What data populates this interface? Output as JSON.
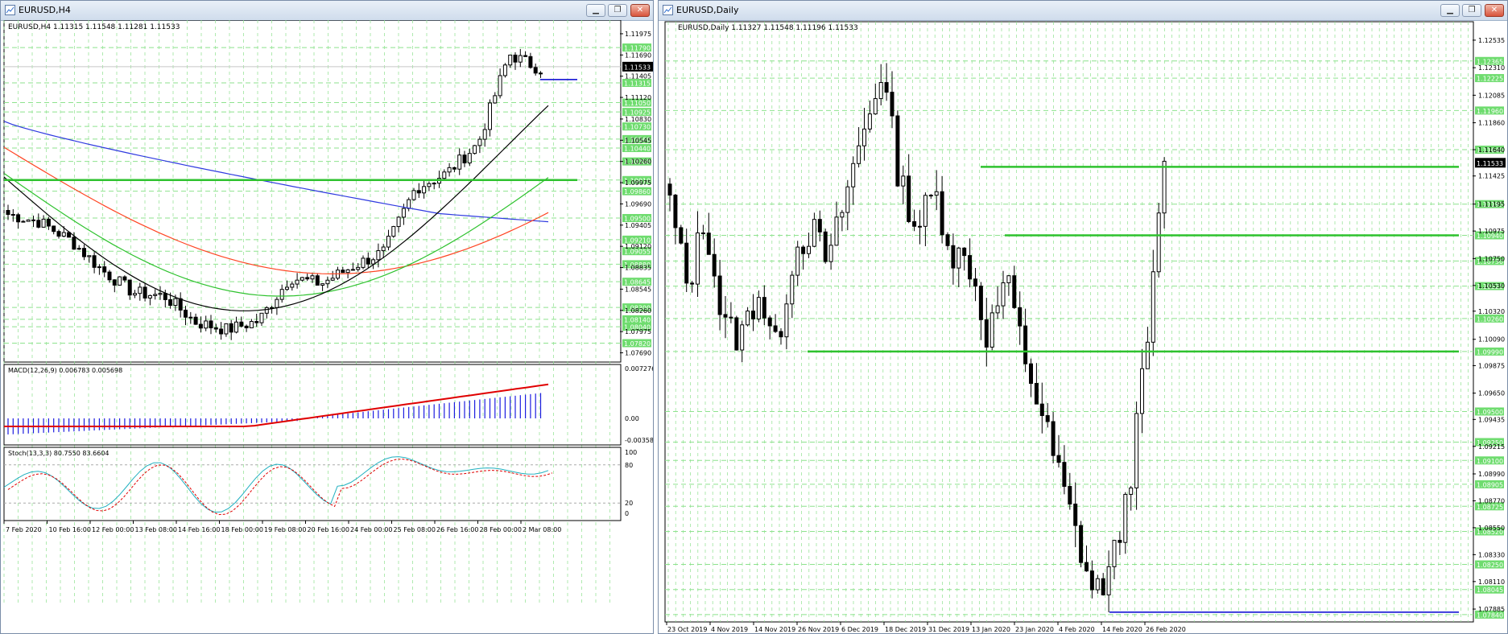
{
  "colors": {
    "accent_green": "#2ec22e",
    "grid_dash": "#8ee28e",
    "ma_blue": "#2f3ae0",
    "ma_red": "#ff4422",
    "ma_green": "#2ec22e",
    "ma_black": "#000000",
    "macd_hist": "#1c1ce0",
    "macd_signal": "#e00000",
    "stoch_main": "#20b0c0",
    "stoch_signal": "#e00000",
    "hline_blue": "#0000d0"
  },
  "icons": {
    "window_icon": "chart-window-icon",
    "minimize": "minimize-icon",
    "restore": "restore-icon",
    "close": "close-icon"
  },
  "left": {
    "title": "EURUSD,H4",
    "ohlc_label": "EURUSD,H4  1.11315 1.11548 1.11281 1.11533",
    "price_axis_ticks": [
      "1.11975",
      "1.11690",
      "1.11405",
      "1.11120",
      "1.10830",
      "1.10545",
      "1.10260",
      "1.09975",
      "1.09690",
      "1.09405",
      "1.09120",
      "1.08835",
      "1.08545",
      "1.08260",
      "1.07975",
      "1.07690"
    ],
    "green_labels": [
      "1.11790",
      "1.11315",
      "1.11050",
      "1.10925",
      "1.10730",
      "1.10560",
      "1.10440",
      "1.10260",
      "1.10010",
      "1.09860",
      "1.09500",
      "1.09210",
      "1.09055",
      "1.08880",
      "1.08645",
      "1.08300",
      "1.08140",
      "1.08040",
      "1.07820"
    ],
    "current_price": "1.11533",
    "macd_label": "MACD(12,26,9) 0.006783 0.005698",
    "macd_ticks": [
      "0.007276",
      "0.00",
      "-0.003586"
    ],
    "stoch_label": "Stoch(13,3,3) 80.7550 83.6604",
    "stoch_ticks": [
      "100",
      "80",
      "20",
      "0"
    ],
    "time_labels": [
      "7 Feb 2020",
      "10 Feb 16:00",
      "12 Feb 00:00",
      "13 Feb 08:00",
      "14 Feb 16:00",
      "18 Feb 00:00",
      "19 Feb 08:00",
      "20 Feb 16:00",
      "24 Feb 00:00",
      "25 Feb 08:00",
      "26 Feb 16:00",
      "28 Feb 00:00",
      "2 Mar 08:00"
    ]
  },
  "right": {
    "title": "EURUSD,Daily",
    "ohlc_label": "EURUSD,Daily  1.11327 1.11548 1.11196 1.11533",
    "price_axis_ticks": [
      "1.12535",
      "1.12310",
      "1.12085",
      "1.11860",
      "1.11640",
      "1.11425",
      "1.11195",
      "1.10975",
      "1.10750",
      "1.10530",
      "1.10320",
      "1.10090",
      "1.09875",
      "1.09650",
      "1.09435",
      "1.09215",
      "1.08990",
      "1.08770",
      "1.08550",
      "1.08330",
      "1.08110",
      "1.07885"
    ],
    "green_labels": [
      "1.12365",
      "1.12225",
      "1.11960",
      "1.11640",
      "1.11195",
      "1.10940",
      "1.10730",
      "1.10525",
      "1.10260",
      "1.09990",
      "1.09500",
      "1.09250",
      "1.09100",
      "1.08905",
      "1.08725",
      "1.08520",
      "1.08250",
      "1.08045",
      "1.07840"
    ],
    "current_price": "1.11533",
    "time_labels": [
      "23 Oct 2019",
      "4 Nov 2019",
      "14 Nov 2019",
      "26 Nov 2019",
      "6 Dec 2019",
      "18 Dec 2019",
      "31 Dec 2019",
      "13 Jan 2020",
      "23 Jan 2020",
      "4 Feb 2020",
      "14 Feb 2020",
      "26 Feb 2020"
    ]
  }
}
